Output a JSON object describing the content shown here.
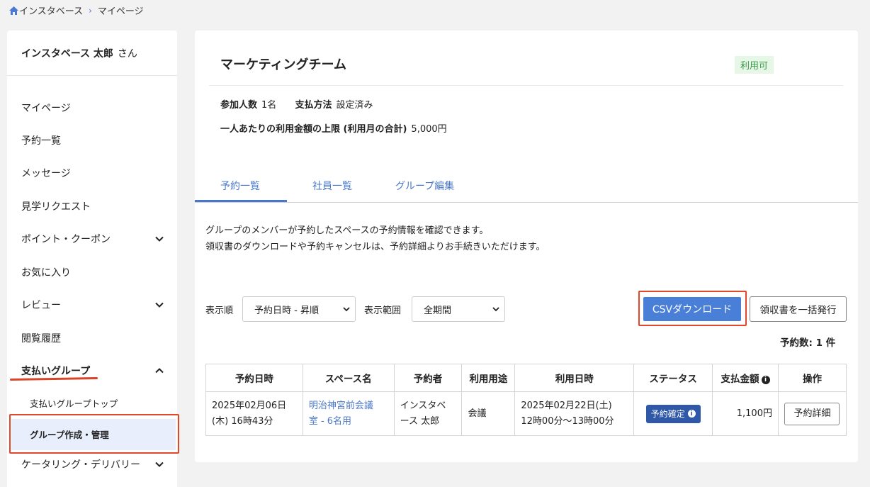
{
  "breadcrumb": {
    "home": "インスタベース",
    "current": "マイページ"
  },
  "sidebar": {
    "user_name": "インスタベース 太郎",
    "user_suffix": "さん",
    "items": [
      {
        "label": "マイページ"
      },
      {
        "label": "予約一覧"
      },
      {
        "label": "メッセージ"
      },
      {
        "label": "見学リクエスト"
      },
      {
        "label": "ポイント・クーポン"
      },
      {
        "label": "お気に入り"
      },
      {
        "label": "レビュー"
      },
      {
        "label": "閲覧履歴"
      },
      {
        "label": "支払いグループ"
      },
      {
        "label": "ケータリング・デリバリー"
      }
    ],
    "sub_items": [
      {
        "label": "支払いグループトップ"
      },
      {
        "label": "グループ作成・管理"
      }
    ]
  },
  "group": {
    "title": "マーケティングチーム",
    "status": "利用可",
    "participants_label": "参加人数",
    "participants_value": "1名",
    "payment_label": "支払方法",
    "payment_value": "設定済み",
    "limit_label": "一人あたりの利用金額の上限 (利用月の合計)",
    "limit_value": "5,000円"
  },
  "tabs": [
    {
      "label": "予約一覧"
    },
    {
      "label": "社員一覧"
    },
    {
      "label": "グループ編集"
    }
  ],
  "description": {
    "line1": "グループのメンバーが予約したスペースの予約情報を確認できます。",
    "line2": "領収書のダウンロードや予約キャンセルは、予約詳細よりお手続きいただけます。"
  },
  "filters": {
    "sort_label": "表示順",
    "sort_value": "予約日時 - 昇順",
    "range_label": "表示範囲",
    "range_value": "全期間"
  },
  "buttons": {
    "csv": "CSVダウンロード",
    "receipt": "領収書を一括発行"
  },
  "count_text": "予約数: 1 件",
  "table": {
    "headers": [
      "予約日時",
      "スペース名",
      "予約者",
      "利用用途",
      "利用日時",
      "ステータス",
      "支払金額",
      "操作"
    ],
    "rows": [
      {
        "reserved_at_1": "2025年02月06日",
        "reserved_at_2": "(木) 16時43分",
        "space_1": "明治神宮前会議",
        "space_2": "室 - 6名用",
        "booker_1": "インスタベ",
        "booker_2": "ース 太郎",
        "purpose": "会議",
        "use_date_1": "2025年02月22日(土)",
        "use_date_2": "12時00分〜13時00分",
        "status": "予約確定",
        "amount": "1,100円",
        "action": "予約詳細"
      }
    ]
  },
  "colors": {
    "accent": "#4a7fd8",
    "highlight": "#e2472a",
    "status_green": "#3d9a49"
  }
}
